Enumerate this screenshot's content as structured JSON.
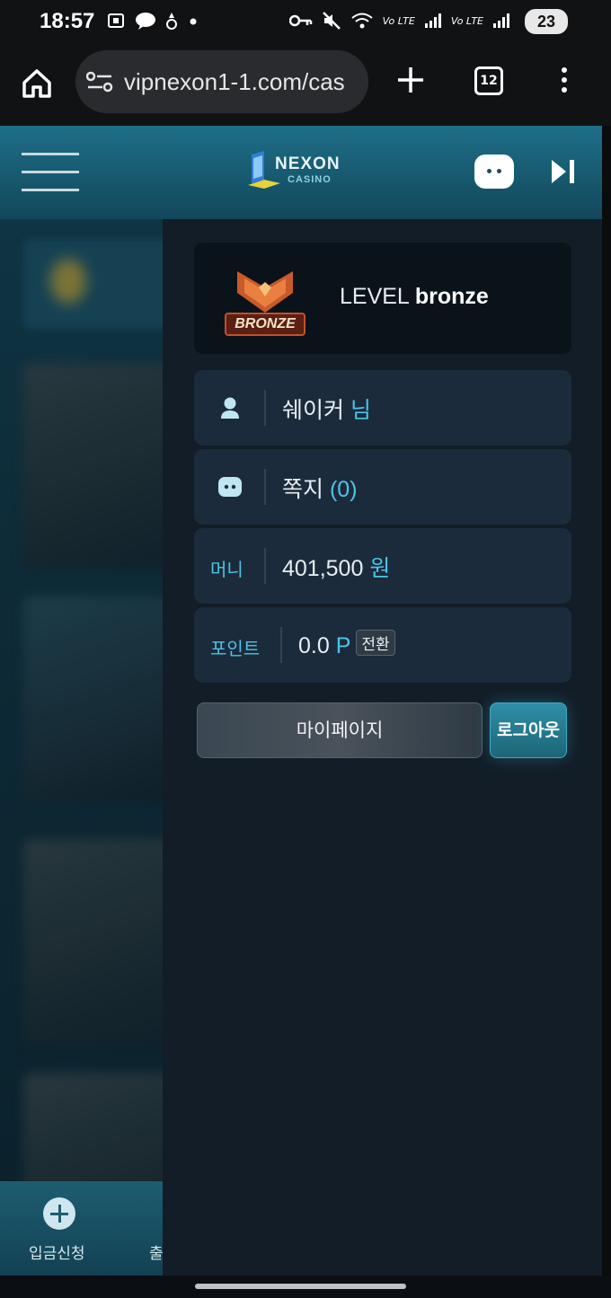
{
  "status_bar": {
    "time": "18:57",
    "left_icons": [
      "screenshot-icon",
      "talk-icon",
      "notification-icon",
      "dot-icon"
    ],
    "right_icons": [
      "key-icon",
      "mute-icon",
      "wifi-icon",
      "lte-signal-icon",
      "lte-signal-icon"
    ],
    "lte_label": "Vo LTE",
    "battery_level": "23"
  },
  "browser": {
    "url": "vipnexon1-1.com/cas",
    "tab_count": "12"
  },
  "header": {
    "logo_word": "NEXON",
    "logo_sub": "CASINO"
  },
  "panel": {
    "badge_text": "BRONZE",
    "level_prefix": "LEVEL",
    "level_value": "bronze",
    "user": {
      "name": "쉐이커",
      "suffix": "님"
    },
    "messages": {
      "label": "쪽지",
      "count": "(0)"
    },
    "money": {
      "label": "머니",
      "value": "401,500",
      "unit": "원"
    },
    "points": {
      "label": "포인트",
      "value": "0.0",
      "unit": "P",
      "convert_label": "전환"
    },
    "mypage_label": "마이페이지",
    "logout_label": "로그아웃"
  },
  "bottom_nav": {
    "deposit_label": "입금신청",
    "withdraw_label": "출"
  },
  "colors": {
    "accent": "#4ec4e6",
    "header_bg": "#1e6f88",
    "panel_bg": "#121d27",
    "row_bg": "#1b2b3b"
  }
}
